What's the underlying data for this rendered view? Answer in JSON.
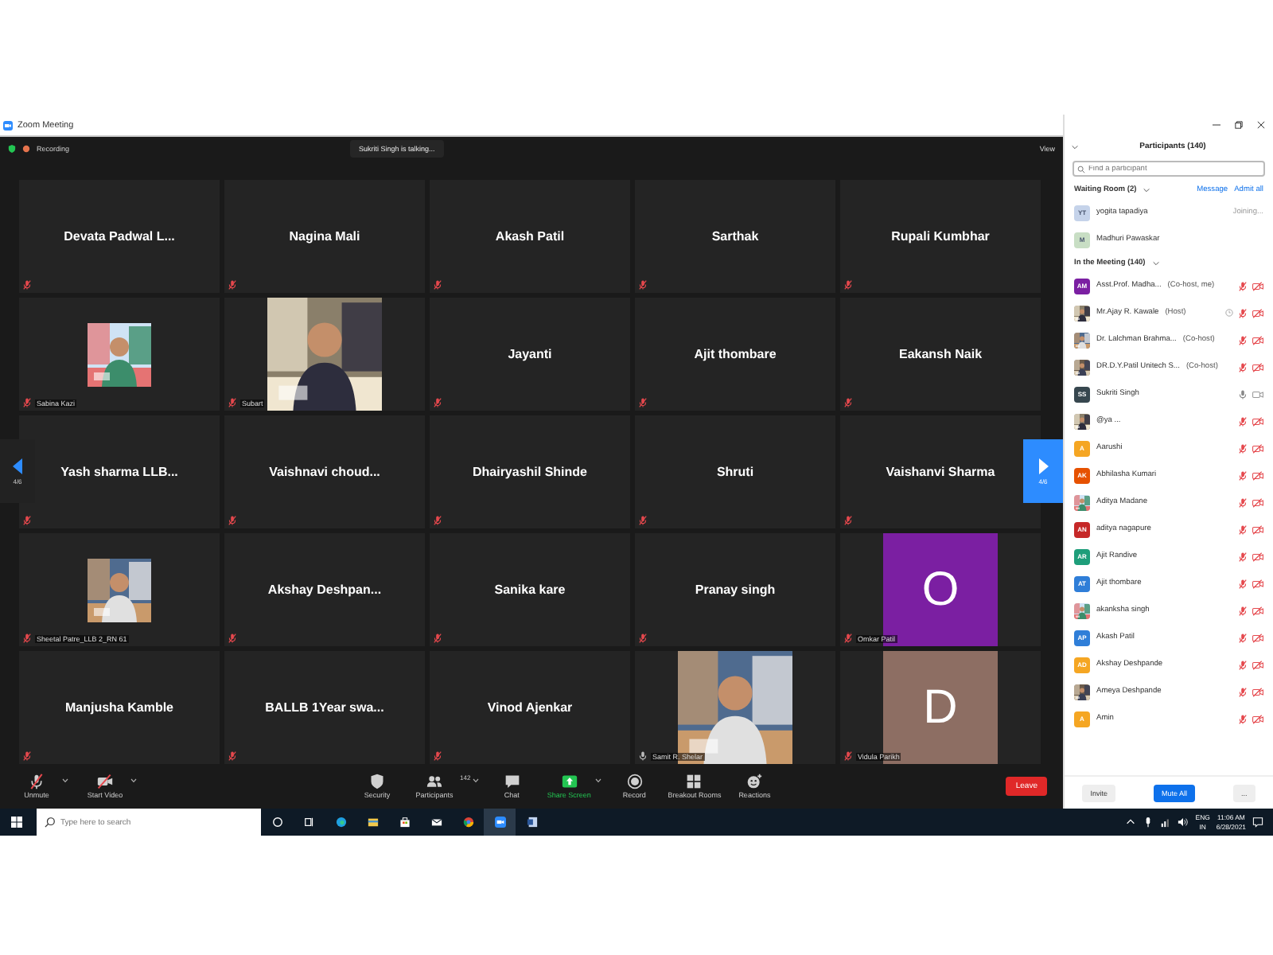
{
  "window": {
    "title": "Zoom Meeting"
  },
  "top_bar": {
    "recording": "Recording",
    "talking": "Sukriti Singh is talking...",
    "view": "View"
  },
  "pager": {
    "left": "4/6",
    "right": "4/6"
  },
  "tiles": [
    {
      "kind": "name",
      "name": "Devata Padwal L...",
      "muted": true
    },
    {
      "kind": "name",
      "name": "Nagina Mali",
      "muted": true
    },
    {
      "kind": "name",
      "name": "Akash Patil",
      "muted": true
    },
    {
      "kind": "name",
      "name": "Sarthak",
      "muted": true
    },
    {
      "kind": "name",
      "name": "Rupali Kumbhar",
      "muted": true
    },
    {
      "kind": "thumbnail",
      "name": "Sabina Kazi",
      "muted": true
    },
    {
      "name": "Subart",
      "muted": true
    },
    {
      "kind": "name",
      "name": "Jayanti",
      "muted": true
    },
    {
      "kind": "name",
      "name": "Ajit thombare",
      "muted": true
    },
    {
      "kind": "name",
      "name": "Eakansh Naik",
      "muted": true
    },
    {
      "kind": "name",
      "name": "Yash sharma LLB...",
      "muted": true
    },
    {
      "kind": "name",
      "name": "Vaishnavi  choud...",
      "muted": true
    },
    {
      "kind": "name",
      "name": "Dhairyashil Shinde",
      "muted": true
    },
    {
      "kind": "name",
      "name": "Shruti",
      "muted": true
    },
    {
      "kind": "name",
      "name": "Vaishanvi Sharma",
      "muted": true
    },
    {
      "kind": "thumbnail",
      "name": "Sheetal Patre_LLB 2_RN 61",
      "muted": true
    },
    {
      "kind": "name",
      "name": "Akshay  Deshpan...",
      "muted": true
    },
    {
      "kind": "name",
      "name": "Sanika kare",
      "muted": true
    },
    {
      "kind": "name",
      "name": "Pranay singh",
      "muted": true
    },
    {
      "kind": "letter",
      "letter": "O",
      "color": "#7b1fa2",
      "name": "Omkar Patil",
      "muted": true
    },
    {
      "kind": "name",
      "name": "Manjusha Kamble",
      "muted": true
    },
    {
      "kind": "name",
      "name": "BALLB 1Year swa...",
      "muted": true
    },
    {
      "kind": "name",
      "name": "Vinod Ajenkar",
      "muted": true
    },
    {
      "name": "Samit R. Shelar",
      "muted": false
    },
    {
      "kind": "letter",
      "letter": "D",
      "color": "#8d6e63",
      "name": "Vidula Parikh",
      "muted": true
    }
  ],
  "toolbar": {
    "items": [
      {
        "kind": "mic",
        "label": "Unmute",
        "caret": true
      },
      {
        "kind": "video",
        "label": "Start Video",
        "caret": true
      },
      {
        "kind": "security",
        "label": "Security",
        "caret": false
      },
      {
        "kind": "participants",
        "label": "Participants",
        "count": "142",
        "caret": true
      },
      {
        "kind": "chat",
        "label": "Chat",
        "caret": false
      },
      {
        "kind": "share",
        "label": "Share Screen",
        "caret": true
      },
      {
        "kind": "record",
        "label": "Record",
        "caret": false
      },
      {
        "kind": "breakout",
        "label": "Breakout Rooms",
        "caret": false
      },
      {
        "kind": "reactions",
        "label": "Reactions",
        "caret": false
      }
    ],
    "leave": "Leave"
  },
  "participants": {
    "title": "Participants (140)",
    "search": {
      "placeholder": "Find a participant"
    },
    "waiting_room": {
      "title": "Waiting Room (2)",
      "message": "Message",
      "admit_all": "Admit all",
      "people": [
        {
          "name": "yogita tapadiya",
          "initials": "YT",
          "color": "#c5d3ea",
          "status": "Joining..."
        },
        {
          "name": "Madhuri Pawaskar",
          "initials": "M",
          "color": "#c8dec4"
        }
      ]
    },
    "in_meeting": {
      "title": "In the Meeting (140)",
      "people": [
        {
          "name": "Asst.Prof. Madha...",
          "role": "(Co-host, me)",
          "kind": "initials",
          "initials": "AM",
          "color": "#7b1fa2",
          "muted": true,
          "video_off": true
        },
        {
          "name": "Mr.Ajay R. Kawale",
          "role": "(Host)",
          "kind": "picture",
          "clock": true,
          "muted": true,
          "video_off": true
        },
        {
          "name": "Dr. Lalchman Brahma...",
          "role": "(Co-host)",
          "kind": "picture",
          "muted": true,
          "video_off": true
        },
        {
          "name": "DR.D.Y.Patil Unitech S...",
          "role": "(Co-host)",
          "kind": "picture",
          "muted": true,
          "video_off": true
        },
        {
          "name": "Sukriti Singh",
          "kind": "initials",
          "initials": "SS",
          "color": "#37474f",
          "muted": false,
          "video_off": false
        },
        {
          "name": "@ya ...",
          "kind": "picture",
          "muted": true,
          "video_off": true
        },
        {
          "name": "Aarushi",
          "kind": "initials",
          "initials": "A",
          "color": "#f5a623",
          "muted": true,
          "video_off": true
        },
        {
          "name": "Abhilasha Kumari",
          "kind": "initials",
          "initials": "AK",
          "color": "#e65100",
          "muted": true,
          "video_off": true
        },
        {
          "name": "Aditya Madane",
          "kind": "picture",
          "muted": true,
          "video_off": true
        },
        {
          "name": "aditya nagapure",
          "kind": "initials",
          "initials": "AN",
          "color": "#c62828",
          "muted": true,
          "video_off": true
        },
        {
          "name": "Ajit Randive",
          "kind": "initials",
          "initials": "AR",
          "color": "#1e9e7a",
          "muted": true,
          "video_off": true
        },
        {
          "name": "Ajit thombare",
          "kind": "initials",
          "initials": "AT",
          "color": "#2f7ed8",
          "muted": true,
          "video_off": true
        },
        {
          "name": "akanksha singh",
          "kind": "picture",
          "muted": true,
          "video_off": true
        },
        {
          "name": "Akash Patil",
          "kind": "initials",
          "initials": "AP",
          "color": "#2f7ed8",
          "muted": true,
          "video_off": true
        },
        {
          "name": "Akshay Deshpande",
          "kind": "initials",
          "initials": "AD",
          "color": "#f5a623",
          "muted": true,
          "video_off": true
        },
        {
          "name": "Ameya Deshpande",
          "kind": "picture",
          "muted": true,
          "video_off": true
        },
        {
          "name": "Amin",
          "kind": "initials",
          "initials": "A",
          "color": "#f5a623",
          "muted": true,
          "video_off": true
        }
      ]
    },
    "footer": {
      "invite": "Invite",
      "mute_all": "Mute All",
      "more": "..."
    }
  },
  "taskbar": {
    "search": {
      "placeholder": "Type here to search"
    },
    "language": "ENG",
    "region": "IN",
    "time": "11:06 AM",
    "date": "6/28/2021"
  }
}
